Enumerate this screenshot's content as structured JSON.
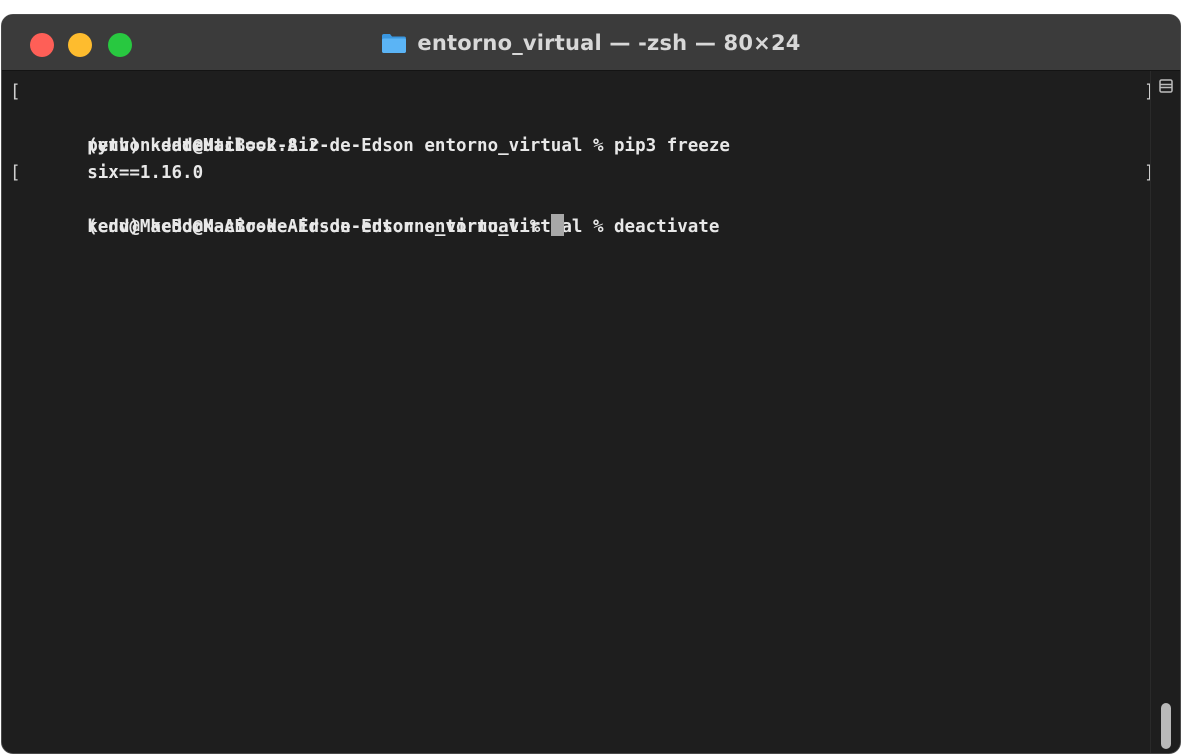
{
  "window": {
    "title": "entorno_virtual — -zsh — 80×24",
    "folder_icon": "folder-icon"
  },
  "colors": {
    "close": "#fe5f57",
    "minimize": "#febc2e",
    "maximize": "#28c840",
    "folder": "#4aa9f0",
    "background": "#1e1e1e",
    "text": "#e8e8e8"
  },
  "terminal": {
    "lines": [
      {
        "text": "(env) kedd@MacBook-Air-de-Edson entorno_virtual % pip3 freeze"
      },
      {
        "text": "python-dateutil==2.8.2"
      },
      {
        "text": "six==1.16.0"
      },
      {
        "text": "(env) kedd@MacBook-Air-de-Edson entorno_virtual % deactivate"
      },
      {
        "text": "kedd@MacBook-Air-de-Edson entorno_virtual % "
      }
    ]
  }
}
